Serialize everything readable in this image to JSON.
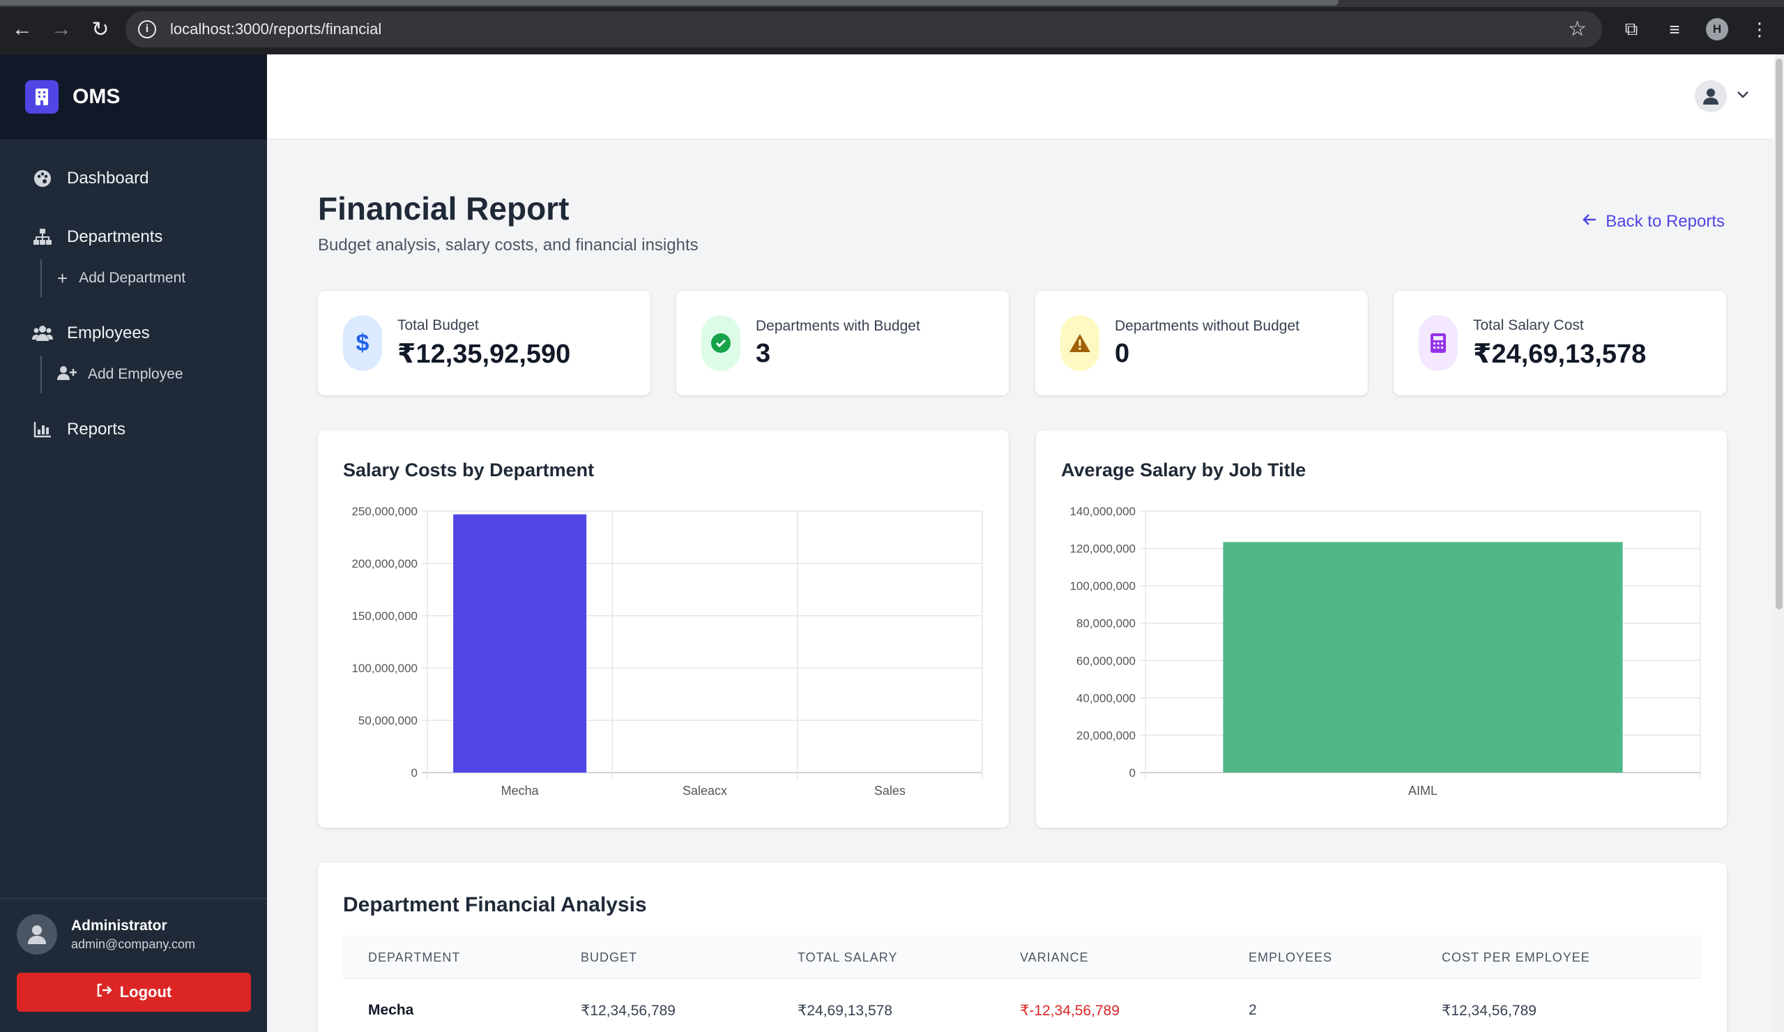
{
  "browser": {
    "url": "localhost:3000/reports/financial",
    "profile_initial": "H"
  },
  "sidebar": {
    "brand": "OMS",
    "items": [
      {
        "label": "Dashboard",
        "icon": "palette-icon"
      },
      {
        "label": "Departments",
        "icon": "sitemap-icon"
      },
      {
        "label": "Add Department",
        "icon": "plus-icon"
      },
      {
        "label": "Employees",
        "icon": "users-icon"
      },
      {
        "label": "Add Employee",
        "icon": "user-plus-icon"
      },
      {
        "label": "Reports",
        "icon": "chart-icon"
      }
    ],
    "user": {
      "name": "Administrator",
      "email": "admin@company.com"
    },
    "logout_label": "Logout"
  },
  "header": {
    "title": "Financial Report",
    "subtitle": "Budget analysis, salary costs, and financial insights",
    "back_label": "Back to Reports"
  },
  "stats": [
    {
      "label": "Total Budget",
      "value": "₹12,35,92,590",
      "icon": "dollar-icon",
      "color": "#2563eb"
    },
    {
      "label": "Departments with Budget",
      "value": "3",
      "icon": "check-circle-icon",
      "color": "#16a34a"
    },
    {
      "label": "Departments without Budget",
      "value": "0",
      "icon": "warning-icon",
      "color": "#ca8a04"
    },
    {
      "label": "Total Salary Cost",
      "value": "₹24,69,13,578",
      "icon": "calculator-icon",
      "color": "#9333ea"
    }
  ],
  "chart_data": [
    {
      "type": "bar",
      "title": "Salary Costs by Department",
      "categories": [
        "Mecha",
        "Saleacx",
        "Sales"
      ],
      "values": [
        246913578,
        0,
        0
      ],
      "ylim": [
        0,
        250000000
      ],
      "yticks": [
        "0",
        "50,000,000",
        "100,000,000",
        "150,000,000",
        "200,000,000",
        "250,000,000"
      ],
      "color": "#4f46e5",
      "grid": true
    },
    {
      "type": "bar",
      "title": "Average Salary by Job Title",
      "categories": [
        "AIML"
      ],
      "values": [
        123456789
      ],
      "ylim": [
        0,
        140000000
      ],
      "yticks": [
        "0",
        "20,000,000",
        "40,000,000",
        "60,000,000",
        "80,000,000",
        "100,000,000",
        "120,000,000",
        "140,000,000"
      ],
      "color": "#52b788",
      "grid": true
    }
  ],
  "table": {
    "title": "Department Financial Analysis",
    "columns": [
      "DEPARTMENT",
      "BUDGET",
      "TOTAL SALARY",
      "VARIANCE",
      "EMPLOYEES",
      "COST PER EMPLOYEE"
    ],
    "rows": [
      [
        "Mecha",
        "₹12,34,56,789",
        "₹24,69,13,578",
        "₹-12,34,56,789",
        "2",
        "₹12,34,56,789"
      ]
    ]
  }
}
